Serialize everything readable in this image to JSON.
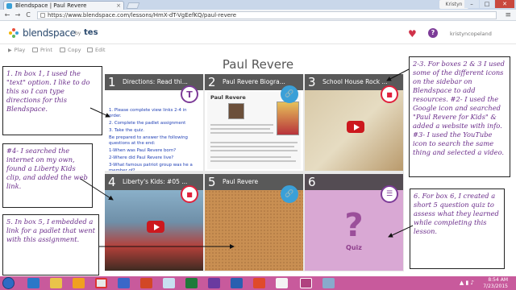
{
  "browser": {
    "tab_title": "Blendspace | Paul Revere",
    "tab_close": "×",
    "user_label": "Kristyn",
    "win_min": "–",
    "win_max": "□",
    "win_close": "✕",
    "back": "←",
    "forward": "→",
    "reload": "C",
    "url": "https://www.blendspace.com/lessons/HmX-dT-VgEefKQ/paul-revere",
    "menu": "≡"
  },
  "app": {
    "brand": "blendspace",
    "by": "by",
    "partner": "tes",
    "heart": "♥",
    "help": "?",
    "username": "kristyncopeland"
  },
  "toolbar": {
    "play": "Play",
    "print": "Print",
    "copy": "Copy",
    "edit": "Edit"
  },
  "lesson": {
    "title": "Paul Revere",
    "tiles": [
      {
        "num": "1",
        "title": "Directions: Read thi...",
        "badge": "T",
        "body": [
          "1. Please complete view links 2-4 in order.",
          "2. Complete the padlet assignment",
          "3. Take the quiz.",
          "Be prepared to answer the following questions at the end:",
          "1-When was Paul Revere born?",
          "2-Where did Paul Revere live?",
          "3-What famous patriot group was he a member of?"
        ]
      },
      {
        "num": "2",
        "title": "Paul Revere Biogra...",
        "badge": "🔗",
        "preview_title": "Paul Revere"
      },
      {
        "num": "3",
        "title": "School House Rock ...",
        "badge": "■"
      },
      {
        "num": "4",
        "title": "Liberty's Kids: #05 ...",
        "badge": "■"
      },
      {
        "num": "5",
        "title": "Paul Revere",
        "badge": "🔗"
      },
      {
        "num": "6",
        "title": "",
        "badge": "☰",
        "quiz_mark": "?",
        "quiz_label": "Quiz"
      }
    ]
  },
  "notes": {
    "n1": "1. In box 1, I used the \"text\" option. I like to do this so I can type directions for this Blendspace.",
    "n2": "2-3. For boxes 2 & 3 I used some of the different icons on the sidebar on Blendspace to add resources. #2- I used the Google icon and searched \"Paul Revere for Kids\" & added a website with info. #3- I used the YouTube icon to search the same thing and selected a video.",
    "n3": "#4- I searched the internet on my own, found a Liberty Kids clip, and added the web link.",
    "n4": "5. In box 5, I embedded a link for a padlet that went with this assignment.",
    "n5": "6. For box 6, I created a short 5 question quiz to assess what they learned while completing this lesson."
  },
  "taskbar": {
    "time": "8:54 AM",
    "date": "7/23/2015",
    "tray": "▲ ▮ ♪"
  },
  "colors": {
    "accent_purple": "#7d3c98",
    "quiz_tile": "#d9a8d4",
    "taskbar": "#c85a9c",
    "video_badge": "#e0213c",
    "link_badge": "#3aa0d8"
  }
}
